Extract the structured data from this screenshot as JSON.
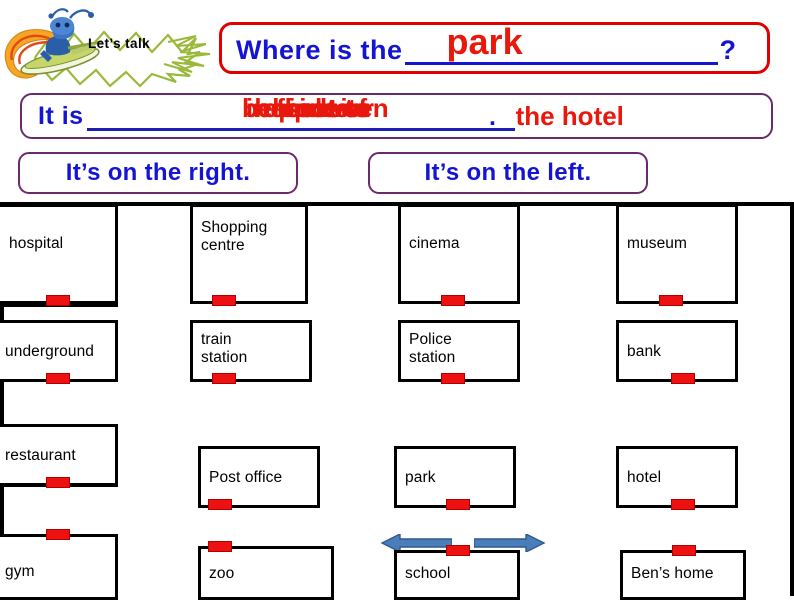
{
  "header": {
    "badge_label": "Let’s talk",
    "badge_icon": "alien-surfer-icon",
    "badge_banner_icon": "lightning-banner-icon"
  },
  "question": {
    "prefix": "Where is the",
    "blank_answer": "park",
    "suffix": "?",
    "text_color": "#1414d2",
    "answer_color": "#e8180c",
    "border_color": "#e00000"
  },
  "answer": {
    "prefix": "It is",
    "stacked_options": [
      "behind",
      "beside",
      "in front of",
      "opposite",
      "next to",
      "between",
      "near"
    ],
    "tail": "the hotel",
    "period": ".",
    "text_color": "#1414d2",
    "option_color": "#e8180c",
    "border_color": "#6b2a6b"
  },
  "direction_boxes": [
    {
      "label": "It’s on the right."
    },
    {
      "label": "It’s on the left."
    }
  ],
  "map": {
    "door_color": "#ee1111",
    "arrow_color": "#4a7ebb",
    "buildings": [
      {
        "name": "hospital",
        "label": "hospital",
        "row": 1
      },
      {
        "name": "shopping-centre",
        "label": "Shopping\ncentre",
        "row": 1
      },
      {
        "name": "cinema",
        "label": "cinema",
        "row": 1
      },
      {
        "name": "museum",
        "label": "museum",
        "row": 1
      },
      {
        "name": "underground",
        "label": "underground",
        "row": 2
      },
      {
        "name": "train-station",
        "label": "train\nstation",
        "row": 2
      },
      {
        "name": "police-station",
        "label": "Police\nstation",
        "row": 2
      },
      {
        "name": "bank",
        "label": "bank",
        "row": 2
      },
      {
        "name": "restaurant",
        "label": "restaurant",
        "row": 3
      },
      {
        "name": "post-office",
        "label": "Post office",
        "row": 3
      },
      {
        "name": "park",
        "label": "park",
        "row": 3
      },
      {
        "name": "hotel",
        "label": "hotel",
        "row": 3
      },
      {
        "name": "gym",
        "label": "gym",
        "row": 4
      },
      {
        "name": "zoo",
        "label": "zoo",
        "row": 4
      },
      {
        "name": "school",
        "label": "school",
        "row": 4
      },
      {
        "name": "bens-home",
        "label": "Ben’s home",
        "row": 4
      }
    ],
    "arrows": [
      {
        "name": "arrow-left",
        "direction": "left"
      },
      {
        "name": "arrow-right",
        "direction": "right"
      }
    ]
  }
}
